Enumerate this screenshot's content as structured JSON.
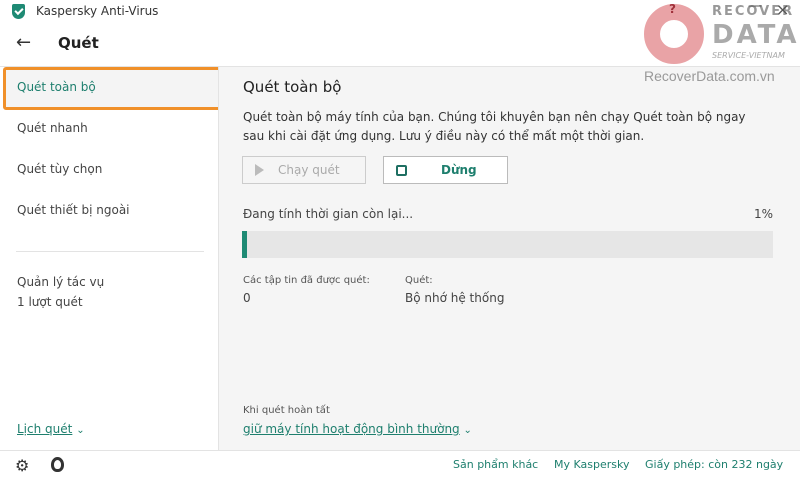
{
  "window": {
    "title": "Kaspersky Anti-Virus",
    "help": "?",
    "minimize": "—",
    "close": "×"
  },
  "header": {
    "back": "←",
    "title": "Quét"
  },
  "sidebar": {
    "items": [
      {
        "label": "Quét toàn bộ",
        "selected": true
      },
      {
        "label": "Quét nhanh"
      },
      {
        "label": "Quét tùy chọn"
      },
      {
        "label": "Quét thiết bị ngoài"
      }
    ],
    "task_manager": "Quản lý tác vụ",
    "task_count": "1 lượt quét",
    "schedule": "Lịch quét",
    "schedule_chevron": "⌄"
  },
  "main": {
    "title": "Quét toàn bộ",
    "description": "Quét toàn bộ máy tính của bạn. Chúng tôi khuyên bạn nên chạy Quét toàn bộ ngay sau khi cài đặt ứng dụng. Lưu ý điều này có thể mất một thời gian.",
    "run_button": "Chạy quét",
    "stop_button": "Dừng",
    "progress_label": "Đang tính thời gian còn lại...",
    "progress_text": "1%",
    "progress_value": 1,
    "files_scanned_label": "Các tập tin đã được quét:",
    "files_scanned": "0",
    "scanning_label": "Quét:",
    "scanning_target": "Bộ nhớ hệ thống",
    "on_complete_label": "Khi quét hoàn tất",
    "on_complete_action": "giữ máy tính hoạt động bình thường"
  },
  "footer": {
    "other_products": "Sản phẩm khác",
    "my_kaspersky": "My Kaspersky",
    "license": "Giấy phép: còn 232 ngày"
  },
  "watermark": {
    "line1": "RECOVER",
    "line2": "DATA",
    "line3": "SERVICE-VIETNAM",
    "url": "RecoverData.com.vn"
  },
  "colors": {
    "accent": "#1e7f6e",
    "highlight": "#f0902a"
  }
}
